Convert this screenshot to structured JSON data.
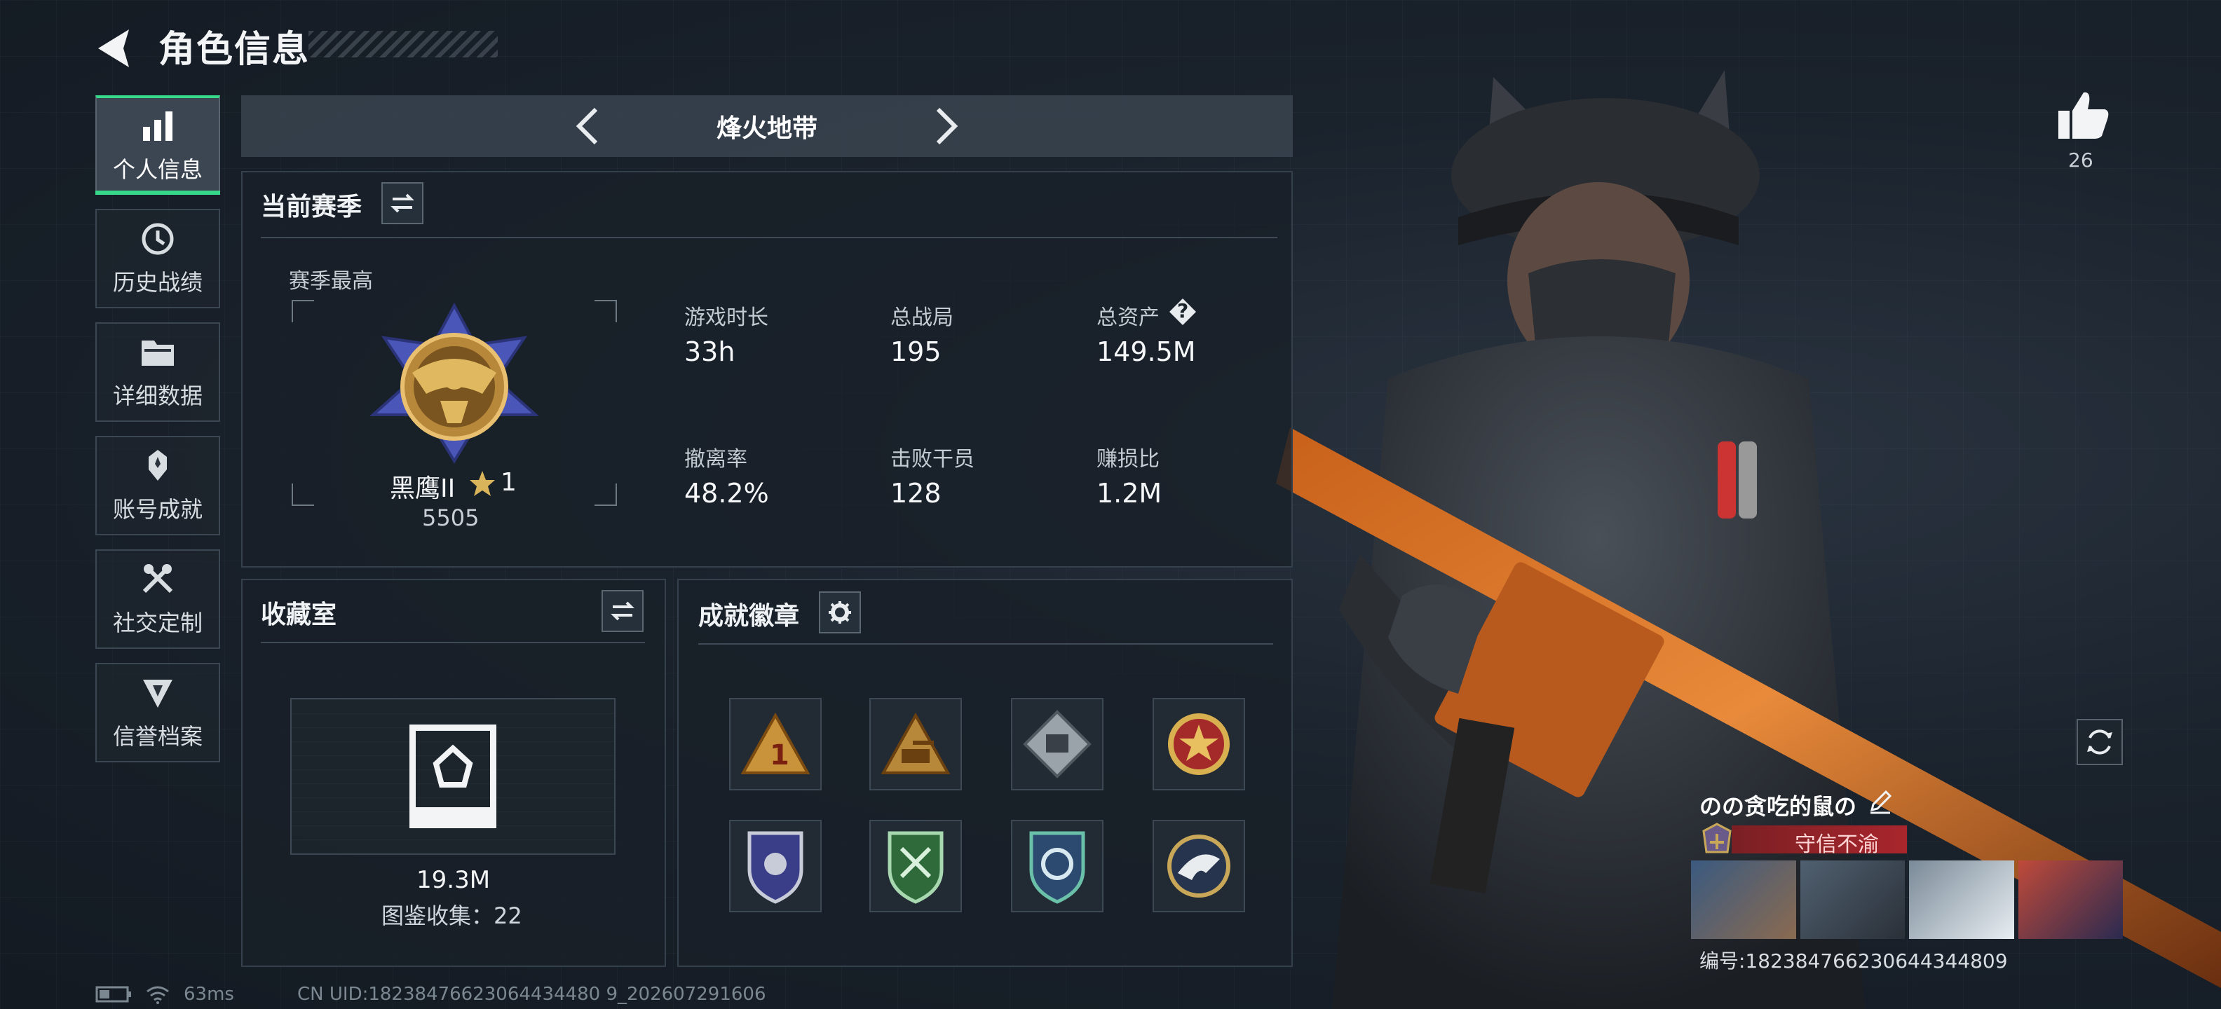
{
  "header": {
    "title": "角色信息"
  },
  "nav": {
    "items": [
      {
        "label": "个人信息",
        "icon": "bar-chart-icon",
        "active": true
      },
      {
        "label": "历史战绩",
        "icon": "history-clock-icon"
      },
      {
        "label": "详细数据",
        "icon": "folder-icon"
      },
      {
        "label": "账号成就",
        "icon": "achievement-medal-icon"
      },
      {
        "label": "社交定制",
        "icon": "tools-icon"
      },
      {
        "label": "信誉档案",
        "icon": "shield-reputation-icon"
      }
    ]
  },
  "mode": {
    "label": "烽火地带"
  },
  "season": {
    "title": "当前赛季",
    "best_label": "赛季最高",
    "rank_name": "黑鹰II",
    "rank_stars": "1",
    "rank_score": "5505",
    "stats": [
      {
        "label": "游戏时长",
        "value": "33h"
      },
      {
        "label": "总战局",
        "value": "195"
      },
      {
        "label": "总资产",
        "value": "149.5M",
        "help": "?"
      },
      {
        "label": "撤离率",
        "value": "48.2%"
      },
      {
        "label": "击败干员",
        "value": "128"
      },
      {
        "label": "赚损比",
        "value": "1.2M"
      }
    ]
  },
  "collection": {
    "title": "收藏室",
    "value": "19.3M",
    "count_text": "图鉴收集：22"
  },
  "achievements": {
    "title": "成就徽章",
    "badges": [
      "badge-triangle-1-icon",
      "badge-triangle-tank-icon",
      "badge-diamond-icon",
      "badge-round-star-icon",
      "badge-police-shield-icon",
      "badge-green-shield-icon",
      "badge-blue-shield-icon",
      "badge-eagle-icon"
    ]
  },
  "likes": {
    "count": "26"
  },
  "player": {
    "name": "のの贪吃的鼠の",
    "title": "守信不渝",
    "id_text": "编号:18238476623064434480​9"
  },
  "status": {
    "ping": "63ms",
    "uid": "CN UID:18238476623064434480 9_202607291606"
  },
  "colors": {
    "accent_green": "#36d98a",
    "title_red": "#a8262c",
    "gold": "#c8933a"
  }
}
